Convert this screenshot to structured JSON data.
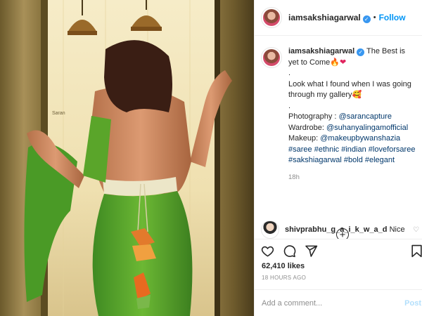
{
  "header": {
    "username": "iamsakshiagarwal",
    "separator": "•",
    "follow_label": "Follow"
  },
  "caption": {
    "username": "iamsakshiagarwal",
    "line1": "The Best is yet to Come",
    "line1_emojis": [
      "🔥",
      "❤"
    ],
    "dot1": ".",
    "line2": "Look what I found when I was going through my gallery",
    "line2_emoji": "🥰",
    "dot2": ".",
    "photography_label": "Photography : ",
    "photography_tag": "@sarancapture",
    "wardrobe_label": "Wardrobe: ",
    "wardrobe_tag": "@suhanyalingamofficial",
    "makeup_label": "Makeup: ",
    "makeup_tag": "@makeupbywanshazia",
    "hashtags": [
      "#saree",
      "#ethnic",
      "#indian",
      "#loveforsaree",
      "#sakshiagarwal",
      "#bold",
      "#elegant"
    ],
    "time": "18h"
  },
  "more_button": "+",
  "comment": {
    "username": "shivprabhu_g_a_i_k_w_a_d",
    "text": "Nice"
  },
  "actions": {
    "like_icon": "heart-icon",
    "comment_icon": "comment-icon",
    "share_icon": "share-icon",
    "save_icon": "bookmark-icon"
  },
  "likes": "62,410 likes",
  "posted": "18 HOURS AGO",
  "comment_input": {
    "placeholder": "Add a comment...",
    "post_label": "Post"
  },
  "photo": {
    "watermark": "Saran"
  },
  "colors": {
    "accent_blue": "#0095f6",
    "tag_blue": "#00376b",
    "saree_green": "#5aa52a",
    "muted": "#8e8e8e"
  }
}
